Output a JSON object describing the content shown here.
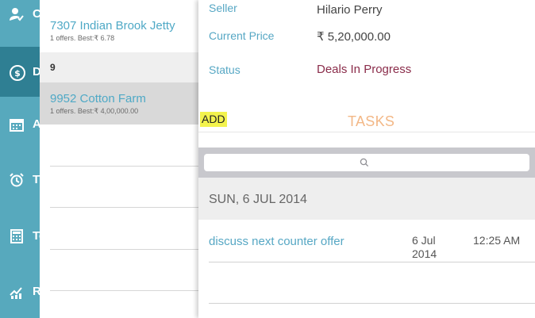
{
  "sidebar": {
    "items": [
      {
        "icon": "user-check-icon",
        "letter": "C"
      },
      {
        "icon": "money-icon",
        "letter": "D"
      },
      {
        "icon": "calendar-icon",
        "letter": "A"
      },
      {
        "icon": "alarm-clock-icon",
        "letter": "T"
      },
      {
        "icon": "calculator-icon",
        "letter": "To"
      },
      {
        "icon": "chart-icon",
        "letter": "R"
      }
    ]
  },
  "deals_list": {
    "items": [
      {
        "title": "7307 Indian Brook Jetty",
        "subtitle": "1 offers. Best:₹ 6.78"
      },
      {
        "title": "9952 Cotton Farm",
        "subtitle": "1 offers. Best:₹ 4,00,000.00"
      }
    ],
    "section_header": "9"
  },
  "detail": {
    "seller_label": "Seller",
    "seller_value": "Hilario Perry",
    "price_label": "Current Price",
    "price_value": "₹ 5,20,000.00",
    "status_label": "Status",
    "status_value": "Deals In Progress",
    "add_label": "ADD",
    "tasks_title": "TASKS",
    "date_header": "SUN, 6 JUL 2014",
    "task": {
      "title": "discuss next counter offer",
      "date": "6 Jul 2014",
      "time": "12:25 AM"
    }
  },
  "colors": {
    "rail": "#57a9bd",
    "rail_active": "#2f7f93",
    "accent": "#56a7c4",
    "status": "#8a2c4a",
    "highlight": "#f3f34d",
    "tasks": "#f3b887"
  }
}
